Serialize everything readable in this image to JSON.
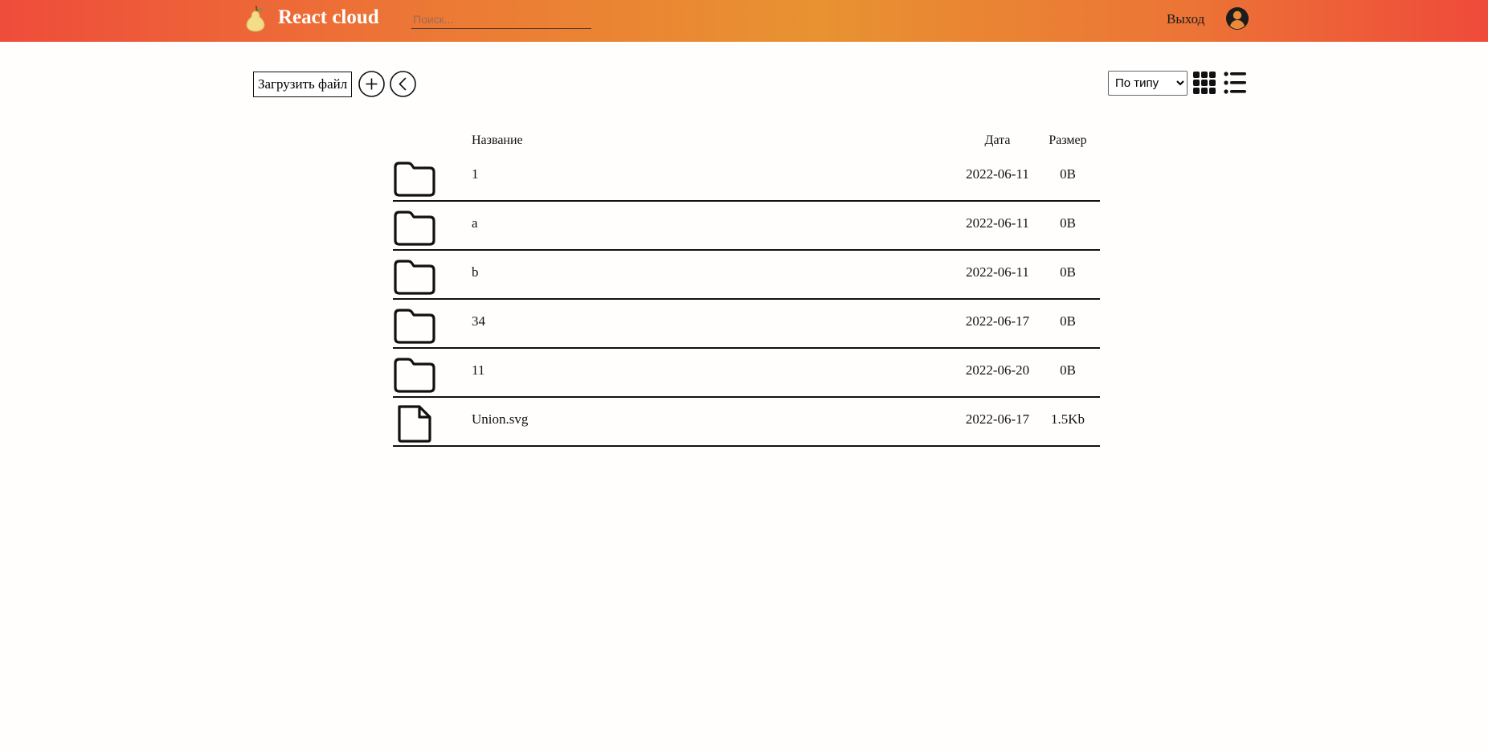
{
  "navbar": {
    "brand": "React cloud",
    "logo_icon": "pear-icon",
    "search_placeholder": "Поиск...",
    "logout_label": "Выход",
    "avatar_icon": "user-avatar-icon"
  },
  "toolbar": {
    "upload_label": "Загрузить файл",
    "add_icon": "plus-circle-icon",
    "back_icon": "chevron-left-circle-icon",
    "sort_selected": "По типу",
    "grid_icon": "grid-view-icon",
    "list_icon": "list-view-icon"
  },
  "table": {
    "headers": {
      "name": "Название",
      "date": "Дата",
      "size": "Размер"
    },
    "rows": [
      {
        "icon": "folder-icon",
        "name": "1",
        "date": "2022-06-11",
        "size": "0B"
      },
      {
        "icon": "folder-icon",
        "name": "a",
        "date": "2022-06-11",
        "size": "0B"
      },
      {
        "icon": "folder-icon",
        "name": "b",
        "date": "2022-06-11",
        "size": "0B"
      },
      {
        "icon": "folder-icon",
        "name": "34",
        "date": "2022-06-17",
        "size": "0B"
      },
      {
        "icon": "folder-icon",
        "name": "11",
        "date": "2022-06-20",
        "size": "0B"
      },
      {
        "icon": "file-icon",
        "name": "Union.svg",
        "date": "2022-06-17",
        "size": "1.5Kb"
      }
    ]
  },
  "colors": {
    "navbar_start": "#ef4c3b",
    "navbar_mid": "#e89231",
    "navbar_end": "#ef4a3a",
    "background": "#fffefd"
  }
}
